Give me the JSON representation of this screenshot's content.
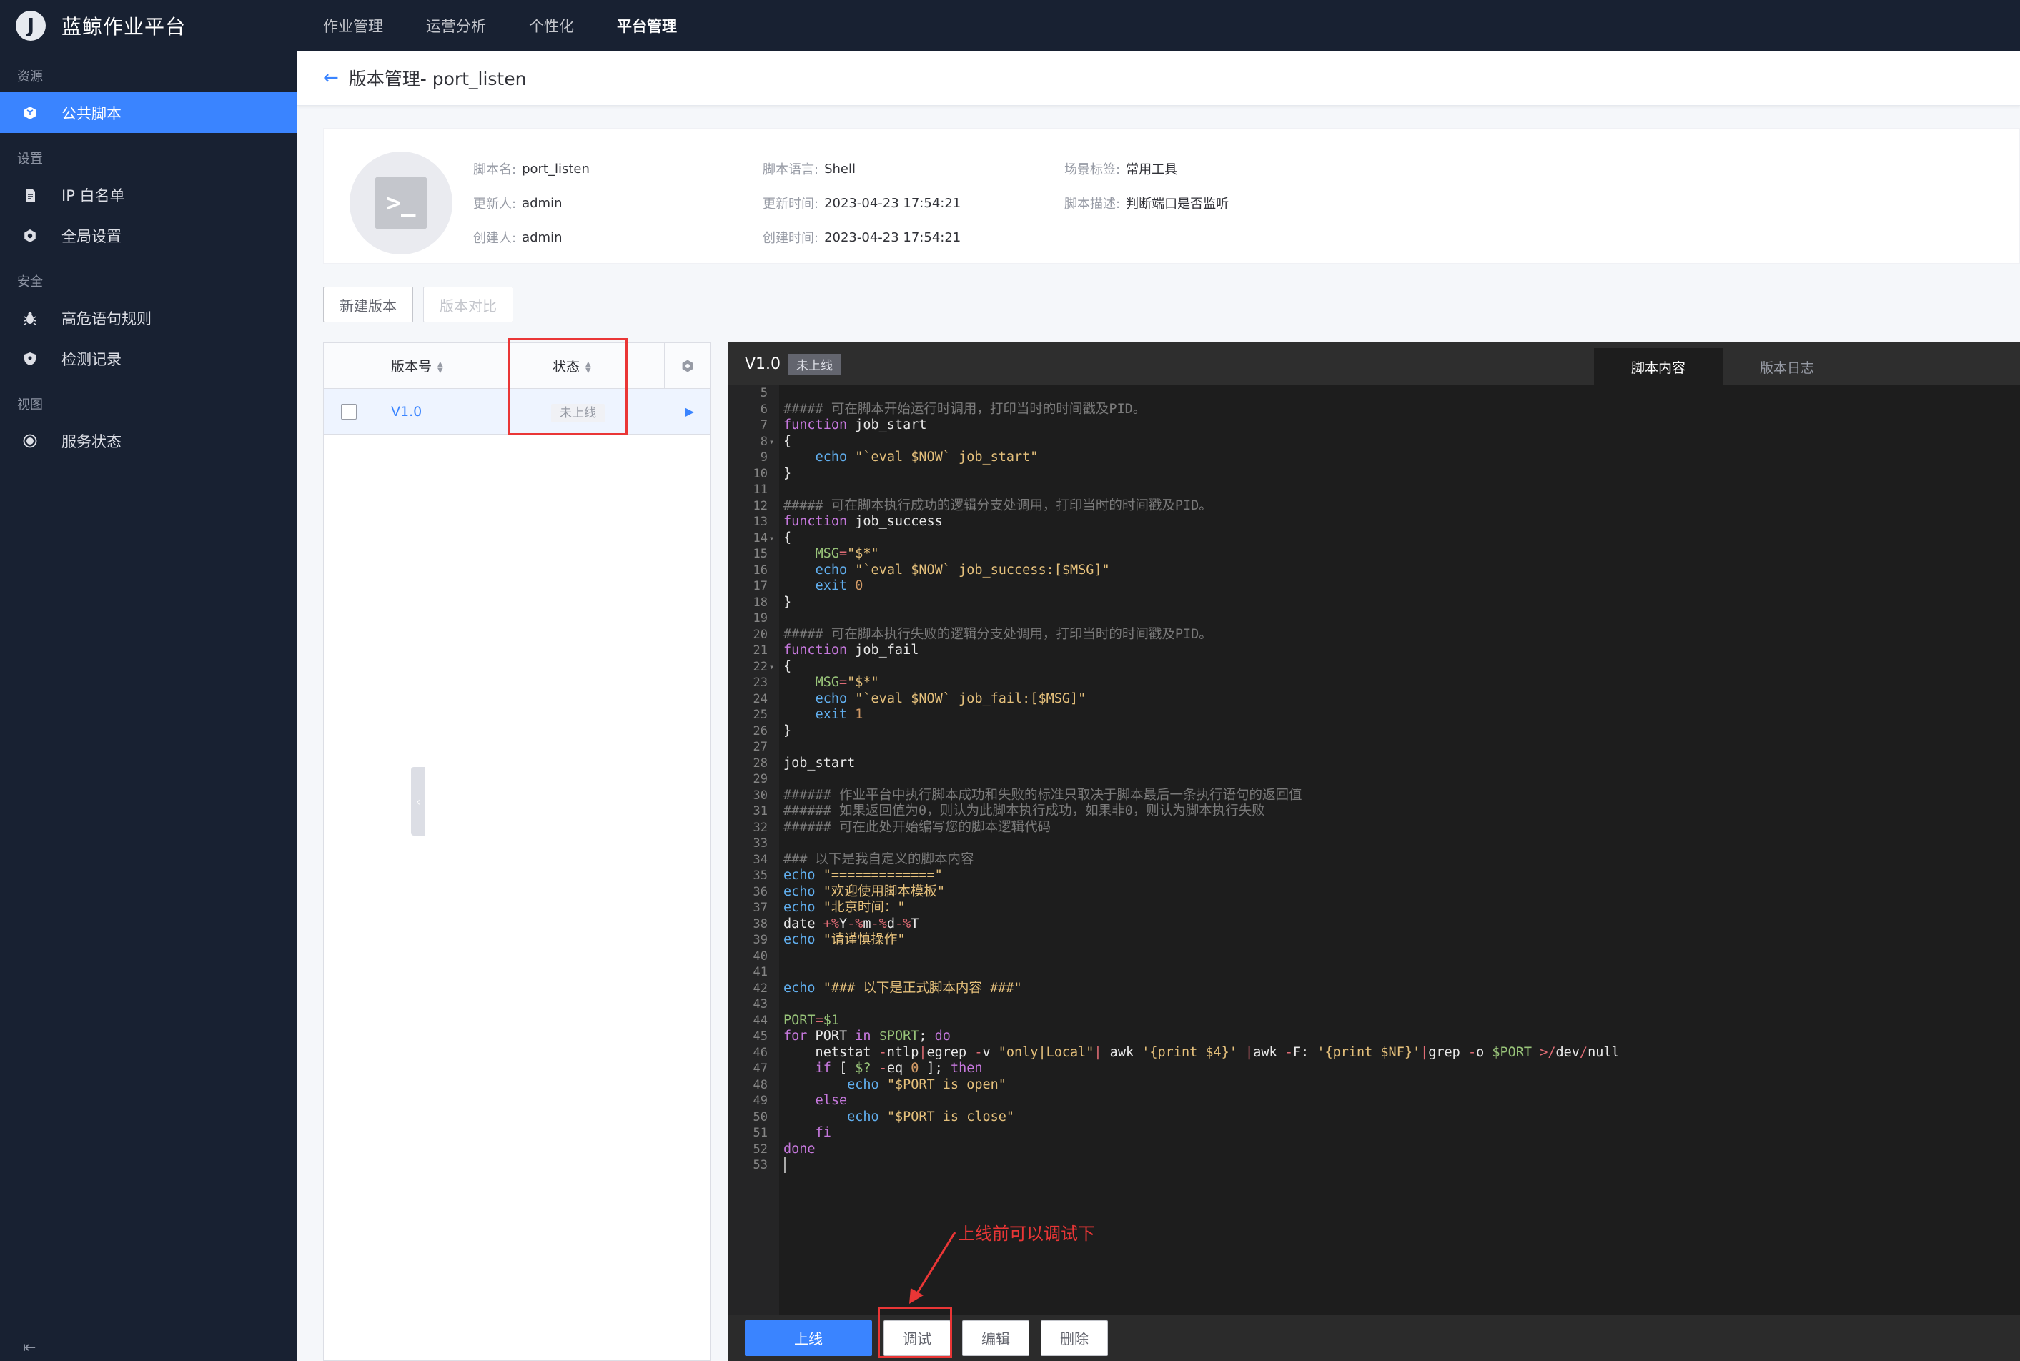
{
  "app": {
    "logo_letter": "J",
    "title": "蓝鲸作业平台"
  },
  "topnav": [
    {
      "label": "作业管理"
    },
    {
      "label": "运营分析"
    },
    {
      "label": "个性化"
    },
    {
      "label": "平台管理"
    }
  ],
  "sidebar": {
    "groups": [
      {
        "label": "资源",
        "items": [
          {
            "label": "公共脚本",
            "icon": "cube-icon"
          }
        ]
      },
      {
        "label": "设置",
        "items": [
          {
            "label": "IP 白名单",
            "icon": "document-icon"
          },
          {
            "label": "全局设置",
            "icon": "gear-icon"
          }
        ]
      },
      {
        "label": "安全",
        "items": [
          {
            "label": "高危语句规则",
            "icon": "bug-icon"
          },
          {
            "label": "检测记录",
            "icon": "shield-icon"
          }
        ]
      },
      {
        "label": "视图",
        "items": [
          {
            "label": "服务状态",
            "icon": "target-icon"
          }
        ]
      }
    ],
    "collapse_glyph": "⇤"
  },
  "page": {
    "title": "版本管理- port_listen"
  },
  "info": {
    "name_label": "脚本名:",
    "name_value": "port_listen",
    "updater_label": "更新人:",
    "updater_value": "admin",
    "creator_label": "创建人:",
    "creator_value": "admin",
    "lang_label": "脚本语言:",
    "lang_value": "Shell",
    "update_time_label": "更新时间:",
    "update_time_value": "2023-04-23 17:54:21",
    "create_time_label": "创建时间:",
    "create_time_value": "2023-04-23 17:54:21",
    "tag_label": "场景标签:",
    "tag_value": "常用工具",
    "desc_label": "脚本描述:",
    "desc_value": "判断端口是否监听"
  },
  "actions": {
    "new_version": "新建版本",
    "compare": "版本对比"
  },
  "table": {
    "col_version": "版本号",
    "col_status": "状态",
    "rows": [
      {
        "version": "V1.0",
        "status": "未上线"
      }
    ]
  },
  "editor": {
    "version": "V1.0",
    "status": "未上线",
    "tab_content": "脚本内容",
    "tab_log": "版本日志",
    "btn_online": "上线",
    "btn_debug": "调试",
    "btn_edit": "编辑",
    "btn_delete": "删除",
    "lines": [
      {
        "n": "5",
        "f": "",
        "t": [
          [
            "",
            ""
          ]
        ]
      },
      {
        "n": "6",
        "f": "",
        "t": [
          [
            "cm",
            "##### 可在脚本开始运行时调用，打印当时的时间戳及PID。"
          ]
        ]
      },
      {
        "n": "7",
        "f": "",
        "t": [
          [
            "kw",
            "function"
          ],
          [
            "tx",
            " job_start"
          ]
        ]
      },
      {
        "n": "8",
        "f": "▾",
        "t": [
          [
            "tx",
            "{"
          ]
        ]
      },
      {
        "n": "9",
        "f": "",
        "t": [
          [
            "tx",
            "    "
          ],
          [
            "bi",
            "echo"
          ],
          [
            "tx",
            " "
          ],
          [
            "str",
            "\"`eval $NOW` job_start\""
          ]
        ]
      },
      {
        "n": "10",
        "f": "",
        "t": [
          [
            "tx",
            "}"
          ]
        ]
      },
      {
        "n": "11",
        "f": "",
        "t": [
          [
            "",
            ""
          ]
        ]
      },
      {
        "n": "12",
        "f": "",
        "t": [
          [
            "cm",
            "##### 可在脚本执行成功的逻辑分支处调用，打印当时的时间戳及PID。"
          ]
        ]
      },
      {
        "n": "13",
        "f": "",
        "t": [
          [
            "kw",
            "function"
          ],
          [
            "tx",
            " job_success"
          ]
        ]
      },
      {
        "n": "14",
        "f": "▾",
        "t": [
          [
            "tx",
            "{"
          ]
        ]
      },
      {
        "n": "15",
        "f": "",
        "t": [
          [
            "tx",
            "    "
          ],
          [
            "var",
            "MSG"
          ],
          [
            "op",
            "="
          ],
          [
            "str",
            "\"$*\""
          ]
        ]
      },
      {
        "n": "16",
        "f": "",
        "t": [
          [
            "tx",
            "    "
          ],
          [
            "bi",
            "echo"
          ],
          [
            "tx",
            " "
          ],
          [
            "str",
            "\"`eval $NOW` job_success:[$MSG]\""
          ]
        ]
      },
      {
        "n": "17",
        "f": "",
        "t": [
          [
            "tx",
            "    "
          ],
          [
            "bi",
            "exit"
          ],
          [
            "tx",
            " "
          ],
          [
            "num",
            "0"
          ]
        ]
      },
      {
        "n": "18",
        "f": "",
        "t": [
          [
            "tx",
            "}"
          ]
        ]
      },
      {
        "n": "19",
        "f": "",
        "t": [
          [
            "",
            ""
          ]
        ]
      },
      {
        "n": "20",
        "f": "",
        "t": [
          [
            "cm",
            "##### 可在脚本执行失败的逻辑分支处调用，打印当时的时间戳及PID。"
          ]
        ]
      },
      {
        "n": "21",
        "f": "",
        "t": [
          [
            "kw",
            "function"
          ],
          [
            "tx",
            " job_fail"
          ]
        ]
      },
      {
        "n": "22",
        "f": "▾",
        "t": [
          [
            "tx",
            "{"
          ]
        ]
      },
      {
        "n": "23",
        "f": "",
        "t": [
          [
            "tx",
            "    "
          ],
          [
            "var",
            "MSG"
          ],
          [
            "op",
            "="
          ],
          [
            "str",
            "\"$*\""
          ]
        ]
      },
      {
        "n": "24",
        "f": "",
        "t": [
          [
            "tx",
            "    "
          ],
          [
            "bi",
            "echo"
          ],
          [
            "tx",
            " "
          ],
          [
            "str",
            "\"`eval $NOW` job_fail:[$MSG]\""
          ]
        ]
      },
      {
        "n": "25",
        "f": "",
        "t": [
          [
            "tx",
            "    "
          ],
          [
            "bi",
            "exit"
          ],
          [
            "tx",
            " "
          ],
          [
            "num",
            "1"
          ]
        ]
      },
      {
        "n": "26",
        "f": "",
        "t": [
          [
            "tx",
            "}"
          ]
        ]
      },
      {
        "n": "27",
        "f": "",
        "t": [
          [
            "",
            ""
          ]
        ]
      },
      {
        "n": "28",
        "f": "",
        "t": [
          [
            "tx",
            "job_start"
          ]
        ]
      },
      {
        "n": "29",
        "f": "",
        "t": [
          [
            "",
            ""
          ]
        ]
      },
      {
        "n": "30",
        "f": "",
        "t": [
          [
            "cm",
            "###### 作业平台中执行脚本成功和失败的标准只取决于脚本最后一条执行语句的返回值"
          ]
        ]
      },
      {
        "n": "31",
        "f": "",
        "t": [
          [
            "cm",
            "###### 如果返回值为0，则认为此脚本执行成功，如果非0，则认为脚本执行失败"
          ]
        ]
      },
      {
        "n": "32",
        "f": "",
        "t": [
          [
            "cm",
            "###### 可在此处开始编写您的脚本逻辑代码"
          ]
        ]
      },
      {
        "n": "33",
        "f": "",
        "t": [
          [
            "",
            ""
          ]
        ]
      },
      {
        "n": "34",
        "f": "",
        "t": [
          [
            "cm",
            "### 以下是我自定义的脚本内容"
          ]
        ]
      },
      {
        "n": "35",
        "f": "",
        "t": [
          [
            "bi",
            "echo"
          ],
          [
            "tx",
            " "
          ],
          [
            "str",
            "\"=============\""
          ]
        ]
      },
      {
        "n": "36",
        "f": "",
        "t": [
          [
            "bi",
            "echo"
          ],
          [
            "tx",
            " "
          ],
          [
            "str",
            "\"欢迎使用脚本模板\""
          ]
        ]
      },
      {
        "n": "37",
        "f": "",
        "t": [
          [
            "bi",
            "echo"
          ],
          [
            "tx",
            " "
          ],
          [
            "str",
            "\"北京时间：\""
          ]
        ]
      },
      {
        "n": "38",
        "f": "",
        "t": [
          [
            "tx",
            "date "
          ],
          [
            "op",
            "+%"
          ],
          [
            "tx",
            "Y"
          ],
          [
            "op",
            "-%"
          ],
          [
            "tx",
            "m"
          ],
          [
            "op",
            "-%"
          ],
          [
            "tx",
            "d"
          ],
          [
            "op",
            "-%"
          ],
          [
            "tx",
            "T"
          ]
        ]
      },
      {
        "n": "39",
        "f": "",
        "t": [
          [
            "bi",
            "echo"
          ],
          [
            "tx",
            " "
          ],
          [
            "str",
            "\"请谨慎操作\""
          ]
        ]
      },
      {
        "n": "40",
        "f": "",
        "t": [
          [
            "",
            ""
          ]
        ]
      },
      {
        "n": "41",
        "f": "",
        "t": [
          [
            "",
            ""
          ]
        ]
      },
      {
        "n": "42",
        "f": "",
        "t": [
          [
            "bi",
            "echo"
          ],
          [
            "tx",
            " "
          ],
          [
            "str",
            "\"### 以下是正式脚本内容 ###\""
          ]
        ]
      },
      {
        "n": "43",
        "f": "",
        "t": [
          [
            "",
            ""
          ]
        ]
      },
      {
        "n": "44",
        "f": "",
        "t": [
          [
            "var",
            "PORT"
          ],
          [
            "op",
            "="
          ],
          [
            "var",
            "$1"
          ]
        ]
      },
      {
        "n": "45",
        "f": "",
        "t": [
          [
            "kw",
            "for"
          ],
          [
            "tx",
            " PORT "
          ],
          [
            "kw",
            "in"
          ],
          [
            "tx",
            " "
          ],
          [
            "var",
            "$PORT"
          ],
          [
            "tx",
            "; "
          ],
          [
            "kw",
            "do"
          ]
        ]
      },
      {
        "n": "46",
        "f": "",
        "t": [
          [
            "tx",
            "    netstat "
          ],
          [
            "op",
            "-"
          ],
          [
            "tx",
            "ntlp"
          ],
          [
            "op",
            "|"
          ],
          [
            "tx",
            "egrep "
          ],
          [
            "op",
            "-"
          ],
          [
            "tx",
            "v "
          ],
          [
            "str",
            "\"only|Local\""
          ],
          [
            "op",
            "|"
          ],
          [
            "tx",
            " awk "
          ],
          [
            "str",
            "'{print $4}'"
          ],
          [
            "tx",
            " "
          ],
          [
            "op",
            "|"
          ],
          [
            "tx",
            "awk "
          ],
          [
            "op",
            "-"
          ],
          [
            "tx",
            "F: "
          ],
          [
            "str",
            "'{print $NF}'"
          ],
          [
            "op",
            "|"
          ],
          [
            "tx",
            "grep "
          ],
          [
            "op",
            "-"
          ],
          [
            "tx",
            "o "
          ],
          [
            "var",
            "$PORT"
          ],
          [
            "tx",
            " "
          ],
          [
            "op",
            ">/"
          ],
          [
            "tx",
            "dev"
          ],
          [
            "op",
            "/"
          ],
          [
            "tx",
            "null"
          ]
        ]
      },
      {
        "n": "47",
        "f": "",
        "t": [
          [
            "tx",
            "    "
          ],
          [
            "kw",
            "if"
          ],
          [
            "tx",
            " [ "
          ],
          [
            "var",
            "$?"
          ],
          [
            "tx",
            " "
          ],
          [
            "op",
            "-"
          ],
          [
            "tx",
            "eq "
          ],
          [
            "num",
            "0"
          ],
          [
            "tx",
            " ]; "
          ],
          [
            "kw",
            "then"
          ]
        ]
      },
      {
        "n": "48",
        "f": "",
        "t": [
          [
            "tx",
            "        "
          ],
          [
            "bi",
            "echo"
          ],
          [
            "tx",
            " "
          ],
          [
            "str",
            "\"$PORT is open\""
          ]
        ]
      },
      {
        "n": "49",
        "f": "",
        "t": [
          [
            "tx",
            "    "
          ],
          [
            "kw",
            "else"
          ]
        ]
      },
      {
        "n": "50",
        "f": "",
        "t": [
          [
            "tx",
            "        "
          ],
          [
            "bi",
            "echo"
          ],
          [
            "tx",
            " "
          ],
          [
            "str",
            "\"$PORT is close\""
          ]
        ]
      },
      {
        "n": "51",
        "f": "",
        "t": [
          [
            "tx",
            "    "
          ],
          [
            "kw",
            "fi"
          ]
        ]
      },
      {
        "n": "52",
        "f": "",
        "t": [
          [
            "kw",
            "done"
          ]
        ]
      },
      {
        "n": "53",
        "f": "",
        "t": [
          [
            "",
            ""
          ]
        ]
      }
    ]
  },
  "annotation": {
    "note": "上线前可以调试下"
  },
  "colors": {
    "header_bg": "#182132",
    "primary": "#3a84ff",
    "annotation": "#ea3636",
    "editor_bg": "#1d1d1d"
  }
}
